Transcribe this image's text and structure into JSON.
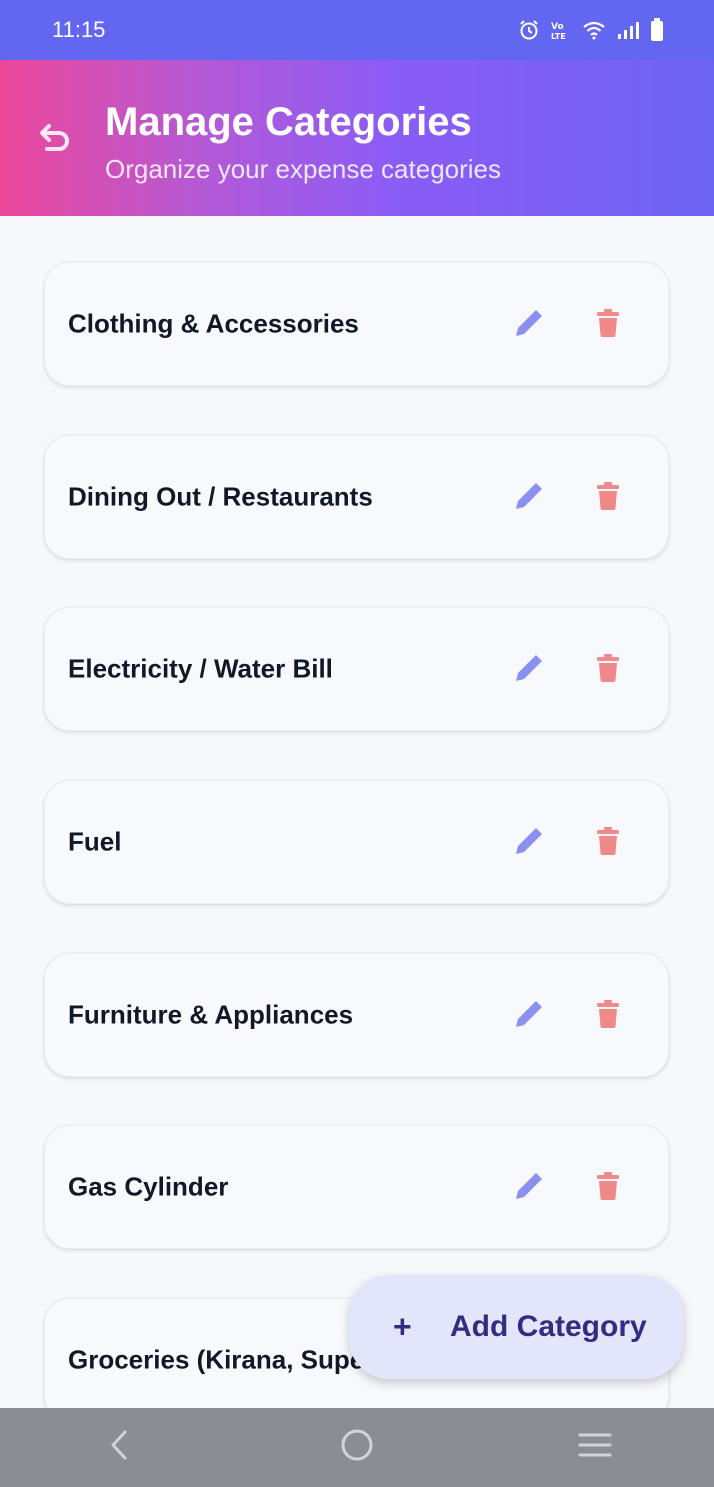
{
  "status_bar": {
    "time": "11:15",
    "icons": [
      "alarm-icon",
      "volte-icon",
      "wifi-icon",
      "signal-icon",
      "battery-icon"
    ]
  },
  "header": {
    "title": "Manage Categories",
    "subtitle": "Organize your expense categories",
    "back_icon": "back-arrow-icon",
    "gradient_colors": [
      "#ec4899",
      "#8b5cf6",
      "#6366f1"
    ]
  },
  "categories": [
    {
      "label": "Clothing & Accessories"
    },
    {
      "label": "Dining Out / Restaurants"
    },
    {
      "label": "Electricity / Water Bill"
    },
    {
      "label": "Fuel"
    },
    {
      "label": "Furniture & Appliances"
    },
    {
      "label": "Gas Cylinder"
    },
    {
      "label": "Groceries (Kirana, Supe"
    }
  ],
  "actions": {
    "edit_icon": "pencil-icon",
    "delete_icon": "trash-icon",
    "edit_color": "#8b8ff0",
    "delete_color": "#f08a8a"
  },
  "fab": {
    "plus": "+",
    "label": "Add Category"
  },
  "nav_bar": {
    "icons": [
      "back-icon",
      "home-icon",
      "recents-icon"
    ]
  }
}
